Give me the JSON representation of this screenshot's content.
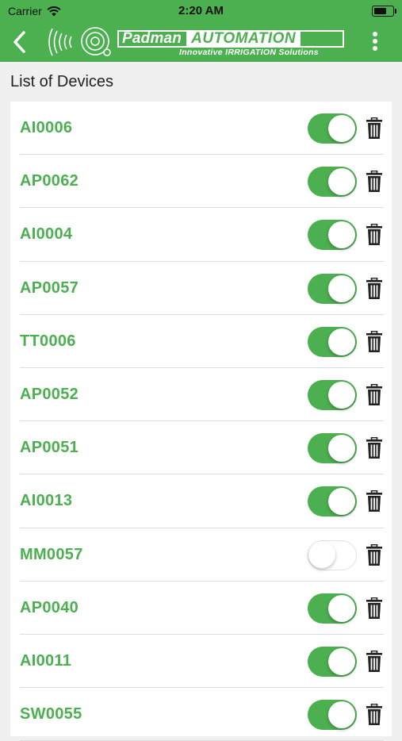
{
  "status_bar": {
    "carrier": "Carrier",
    "time": "2:20 AM"
  },
  "nav": {
    "brand_main": "Padman",
    "brand_accent": "AUTOMATION",
    "tagline": "Innovative IRRIGATION Solutions",
    "back_icon": "chevron-left-icon",
    "menu_icon": "more-vertical-icon"
  },
  "section_title": "List of Devices",
  "colors": {
    "accent": "#4caf50"
  },
  "devices": [
    {
      "name": "AI0006",
      "enabled": true
    },
    {
      "name": "AP0062",
      "enabled": true
    },
    {
      "name": "AI0004",
      "enabled": true
    },
    {
      "name": "AP0057",
      "enabled": true
    },
    {
      "name": "TT0006",
      "enabled": true
    },
    {
      "name": "AP0052",
      "enabled": true
    },
    {
      "name": "AP0051",
      "enabled": true
    },
    {
      "name": "AI0013",
      "enabled": true
    },
    {
      "name": "MM0057",
      "enabled": false
    },
    {
      "name": "AP0040",
      "enabled": true
    },
    {
      "name": "AI0011",
      "enabled": true
    },
    {
      "name": "SW0055",
      "enabled": true
    }
  ]
}
